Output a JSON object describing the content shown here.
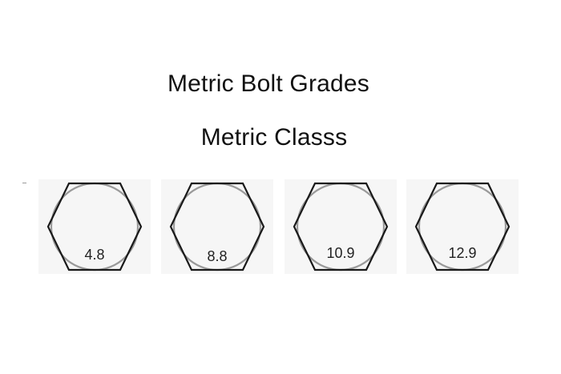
{
  "header": {
    "title": "Metric Bolt Grades",
    "subtitle": "Metric Classs"
  },
  "bolts": [
    {
      "label": "4.8"
    },
    {
      "label": "8.8"
    },
    {
      "label": "10.9"
    },
    {
      "label": "12.9"
    }
  ],
  "colors": {
    "background": "#ffffff",
    "hex_outline": "#1a1a1a",
    "circle_outline": "#9a9a9a",
    "tile_background": "#f6f6f6"
  }
}
